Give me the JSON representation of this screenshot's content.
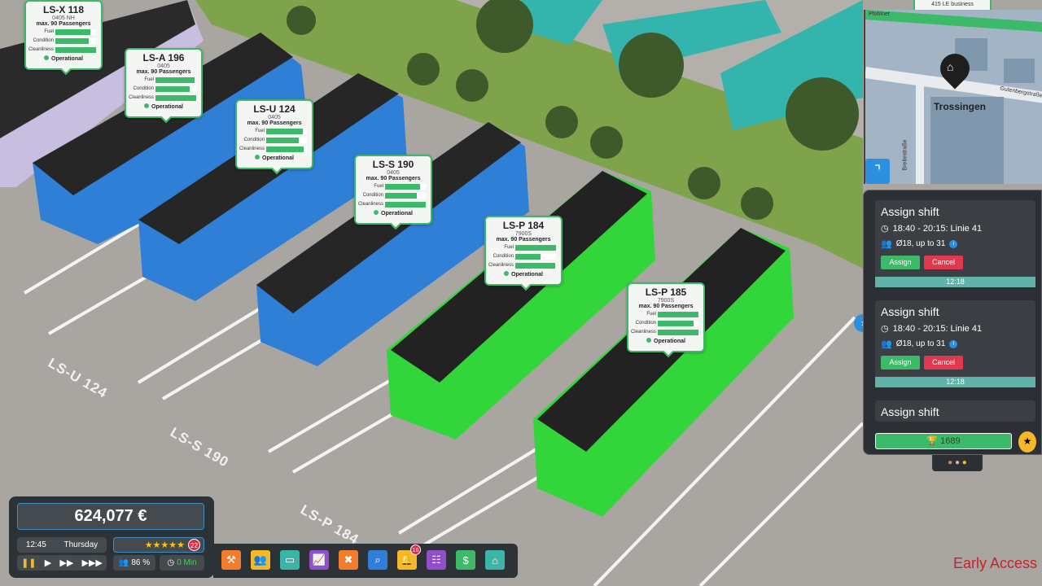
{
  "buses": [
    {
      "id": "LS-X 118",
      "model": "0405 NH",
      "capacity": "max. 90 Passengers",
      "fuel": 0.85,
      "condition": 0.82,
      "cleanliness": 1.0,
      "status": "Operational"
    },
    {
      "id": "LS-A 196",
      "model": "0405",
      "capacity": "max. 90 Passengers",
      "fuel": 0.95,
      "condition": 0.83,
      "cleanliness": 1.0,
      "status": "Operational"
    },
    {
      "id": "LS-U 124",
      "model": "0405",
      "capacity": "max. 90 Passengers",
      "fuel": 0.9,
      "condition": 0.8,
      "cleanliness": 0.92,
      "status": "Operational"
    },
    {
      "id": "LS-S 190",
      "model": "0405",
      "capacity": "max. 90 Passengers",
      "fuel": 0.85,
      "condition": 0.77,
      "cleanliness": 1.0,
      "status": "Operational"
    },
    {
      "id": "LS-P 184",
      "model": "7900S",
      "capacity": "max. 90 Passengers",
      "fuel": 1.0,
      "condition": 0.62,
      "cleanliness": 0.98,
      "status": "Operational"
    },
    {
      "id": "LS-P 185",
      "model": "7900S",
      "capacity": "max. 90 Passengers",
      "fuel": 1.0,
      "condition": 0.88,
      "cleanliness": 1.0,
      "status": "Operational"
    }
  ],
  "bar_labels": {
    "fuel": "Fuel",
    "condition": "Condition",
    "cleanliness": "Cleanliness"
  },
  "partial_tip": {
    "model": "415 LE business"
  },
  "floor_labels": [
    "LS-U 124",
    "LS-S 190",
    "LS-P 184"
  ],
  "map": {
    "depot": "Trossingen",
    "street1": "Gutenbergstraße",
    "street2": "Breitestraße",
    "street3": "Pfohlner"
  },
  "shifts": [
    {
      "title": "Assign shift",
      "time": "18:40 - 20:15: Linie 41",
      "passengers": "Ø18, up to 31",
      "assign": "Assign",
      "cancel": "Cancel",
      "deadline": "12:18"
    },
    {
      "title": "Assign shift",
      "time": "18:40 - 20:15: Linie 41",
      "passengers": "Ø18, up to 31",
      "assign": "Assign",
      "cancel": "Cancel",
      "deadline": "12:18"
    },
    {
      "title": "Assign shift"
    }
  ],
  "score": "1689",
  "hud": {
    "money": "624,077 €",
    "time": "12:45",
    "day": "Thursday",
    "rating_stars": 5,
    "rating_count": "22",
    "satisfaction": "86 %",
    "delay": "0 Min"
  },
  "toolbar": [
    {
      "icon": "tools-icon",
      "color": "#f07c2c"
    },
    {
      "icon": "staff-icon",
      "color": "#f5b82a"
    },
    {
      "icon": "bus-icon",
      "color": "#3cb5a8"
    },
    {
      "icon": "statistics-icon",
      "color": "#8e4fc9"
    },
    {
      "icon": "workshop-icon",
      "color": "#f07c2c"
    },
    {
      "icon": "search-window-icon",
      "color": "#2f7fd8"
    },
    {
      "icon": "bell-icon",
      "color": "#f5b82a",
      "badge": "16"
    },
    {
      "icon": "schedule-icon",
      "color": "#8e4fc9"
    },
    {
      "icon": "finance-icon",
      "color": "#3cba6a"
    },
    {
      "icon": "depot-icon",
      "color": "#3cb5a8"
    }
  ],
  "early_access": "Early Access"
}
